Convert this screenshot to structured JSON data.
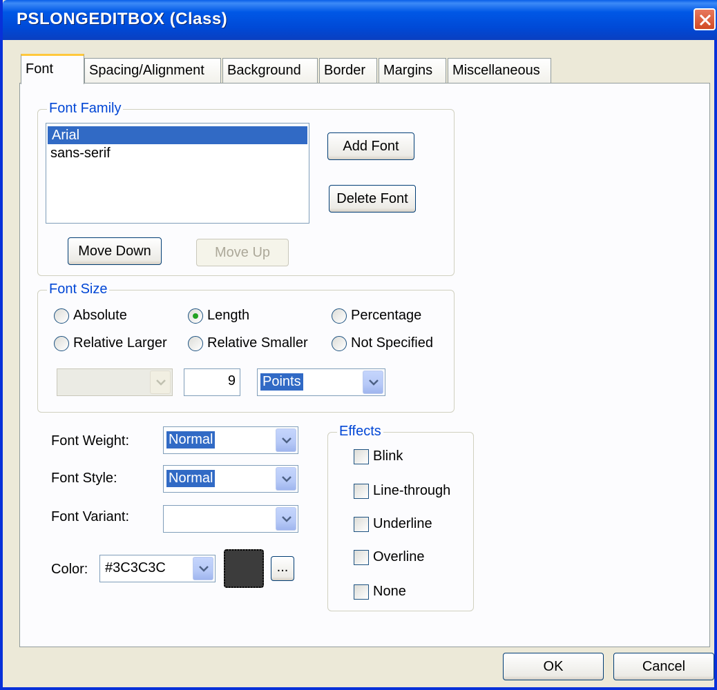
{
  "window": {
    "title": "PSLONGEDITBOX (Class)"
  },
  "tabs": [
    {
      "label": "Font"
    },
    {
      "label": "Spacing/Alignment"
    },
    {
      "label": "Background"
    },
    {
      "label": "Border"
    },
    {
      "label": "Margins"
    },
    {
      "label": "Miscellaneous"
    }
  ],
  "font_family": {
    "group_label": "Font Family",
    "items": [
      "Arial",
      "sans-serif"
    ],
    "selected": "Arial",
    "add_font": "Add Font",
    "delete_font": "Delete Font",
    "move_down": "Move Down",
    "move_up": "Move Up"
  },
  "font_size": {
    "group_label": "Font Size",
    "options": {
      "absolute": "Absolute",
      "length": "Length",
      "percentage": "Percentage",
      "relative_larger": "Relative Larger",
      "relative_smaller": "Relative Smaller",
      "not_specified": "Not Specified"
    },
    "selected": "Length",
    "absolute_value": "",
    "size_value": "9",
    "unit": "Points"
  },
  "font_weight": {
    "label": "Font Weight:",
    "value": "Normal"
  },
  "font_style": {
    "label": "Font Style:",
    "value": "Normal"
  },
  "font_variant": {
    "label": "Font Variant:",
    "value": ""
  },
  "color": {
    "label": "Color:",
    "value": "#3C3C3C",
    "swatch": "#3c3c3c",
    "more": "..."
  },
  "effects": {
    "group_label": "Effects",
    "blink": "Blink",
    "line_through": "Line-through",
    "underline": "Underline",
    "overline": "Overline",
    "none": "None"
  },
  "buttons": {
    "ok": "OK",
    "cancel": "Cancel"
  }
}
